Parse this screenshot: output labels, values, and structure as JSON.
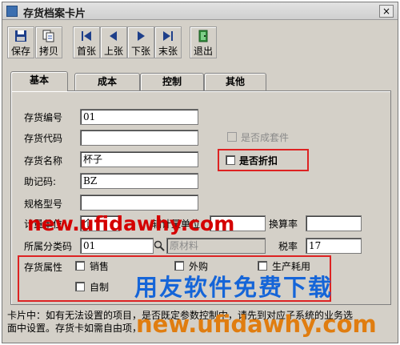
{
  "window": {
    "title": "存货档案卡片",
    "close": "×"
  },
  "toolbar": {
    "save": "保存",
    "copy": "拷贝",
    "first": "首张",
    "prev": "上张",
    "next": "下张",
    "last": "末张",
    "exit": "退出"
  },
  "tabs": [
    "基本",
    "成本",
    "控制",
    "其他"
  ],
  "form": {
    "code_label": "存货编号",
    "code_value": "01",
    "alias_label": "存货代码",
    "alias_value": "",
    "name_label": "存货名称",
    "name_value": "杯子",
    "mnemonic_label": "助记码:",
    "mnemonic_value": "BZ",
    "spec_label": "规格型号",
    "spec_value": "",
    "unit_label": "计量单位",
    "unit_value": "个",
    "aux_unit_label": "辅计量单位",
    "aux_unit_value": "",
    "rate_label": "换算率",
    "rate_value": "",
    "category_label": "所属分类码",
    "category_value": "01",
    "category_name": "原材料",
    "tax_label": "税率",
    "tax_value": "17",
    "set_label": "是否成套件",
    "discount_label": "是否折扣"
  },
  "attributes": {
    "title": "存货属性",
    "sales": "销售",
    "purchase": "外购",
    "production": "生产耗用",
    "self_made": "自制"
  },
  "status": {
    "line1": "卡片中：如有无法设置的项目，是否既定参数控制中，请先到对应子系统的业务选",
    "line2": "面中设置。存货卡如需自由项，"
  },
  "watermark": {
    "url_top": "new.ufidawhy.com",
    "cn": "用友软件免费下载",
    "url_bottom": "new.ufidawhy.com"
  }
}
